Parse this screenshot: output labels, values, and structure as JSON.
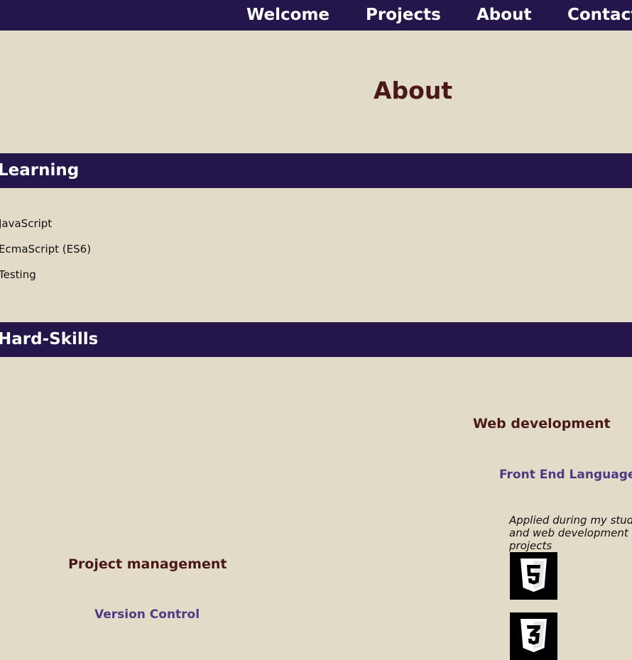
{
  "nav": {
    "items": [
      {
        "label": "Welcome"
      },
      {
        "label": "Projects"
      },
      {
        "label": "About"
      },
      {
        "label": "Contact"
      }
    ]
  },
  "page": {
    "title": "About"
  },
  "learning": {
    "heading": "Learning",
    "items": [
      "JavaScript",
      "EcmaScript (ES6)",
      "Testing"
    ]
  },
  "hard_skills": {
    "heading": "Hard-Skills",
    "web_development": {
      "title": "Web development",
      "subtitle": "Front End Languages",
      "note": "Applied during my studies and web development projects",
      "icons": [
        "html5-icon",
        "css3-icon"
      ]
    },
    "project_management": {
      "title": "Project management",
      "subtitle": "Version Control"
    }
  },
  "colors": {
    "background": "#e2dbc7",
    "bar": "#24164a",
    "heading": "#4a1818",
    "subheading": "#4e3a84"
  }
}
